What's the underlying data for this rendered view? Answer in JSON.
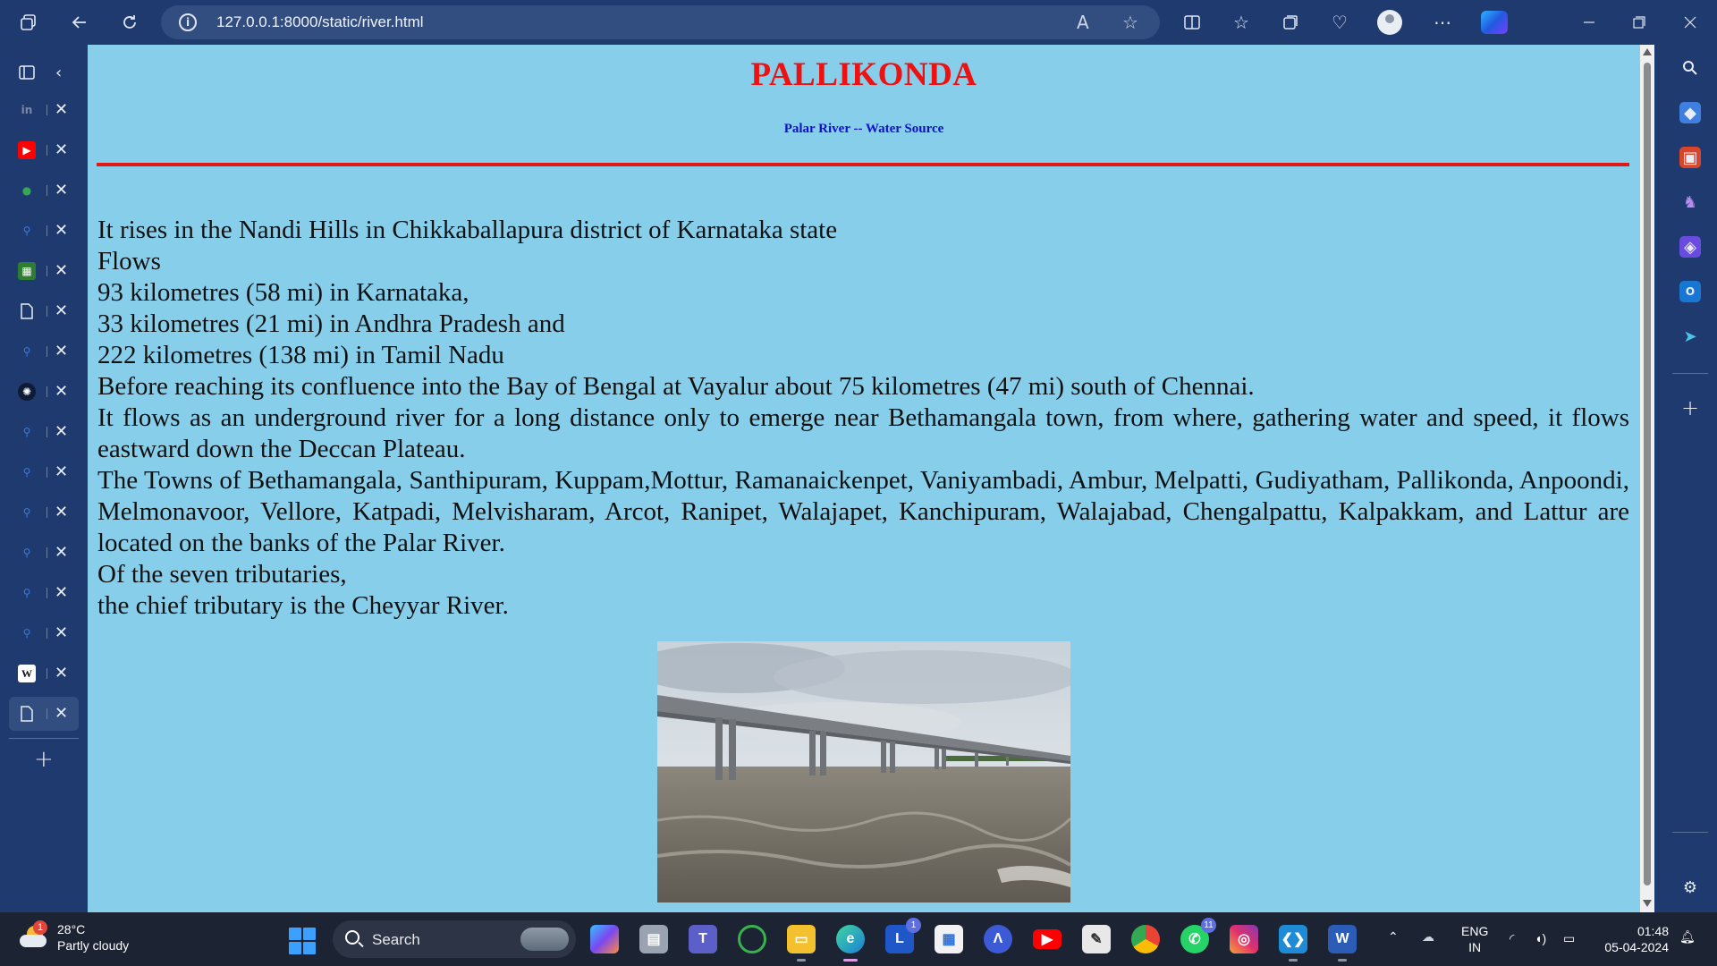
{
  "browser": {
    "url": "127.0.0.1:8000/static/river.html"
  },
  "page": {
    "title": "PALLIKONDA",
    "subtitle": "Palar River -- Water Source",
    "lines": [
      "It rises in the Nandi Hills in Chikkaballapura district of Karnataka state",
      "Flows",
      "93 kilometres (58 mi) in Karnataka,",
      "33 kilometres (21 mi) in Andhra Pradesh and",
      "222 kilometres (138 mi) in Tamil Nadu",
      "Before reaching its confluence into the Bay of Bengal at Vayalur about 75 kilometres (47 mi) south of Chennai.",
      "It flows as an underground river for a long distance only to emerge near Bethamangala town, from where, gathering water and speed, it flows eastward down the Deccan Plateau.",
      "The Towns of Bethamangala, Santhipuram, Kuppam,Mottur, Ramanaickenpet, Vaniyambadi, Ambur, Melpatti, Gudiyatham, Pallikonda, Anpoondi, Melmonavoor, Vellore, Katpadi, Melvisharam, Arcot, Ranipet, Walajapet, Kanchipuram, Walajabad, Chengalpattu, Kalpakkam, and Lattur are located on the banks of the Palar River.",
      "Of the seven tributaries,",
      "the chief tributary is the Cheyyar River."
    ],
    "image": "photo of a long concrete bridge over a flowing river under a cloudy sky"
  },
  "taskbar": {
    "weather_temp": "28°C",
    "weather_desc": "Partly cloudy",
    "weather_badge": "1",
    "search_label": "Search",
    "lang_line1": "ENG",
    "lang_line2": "IN",
    "time": "01:48",
    "date": "05-04-2024",
    "badge_l": "1",
    "badge_whatsapp": "11"
  },
  "colors": {
    "page_bg": "#87ceeb",
    "title": "#ee1111",
    "subtitle": "#1010cc",
    "chrome": "#1f3a6e"
  }
}
